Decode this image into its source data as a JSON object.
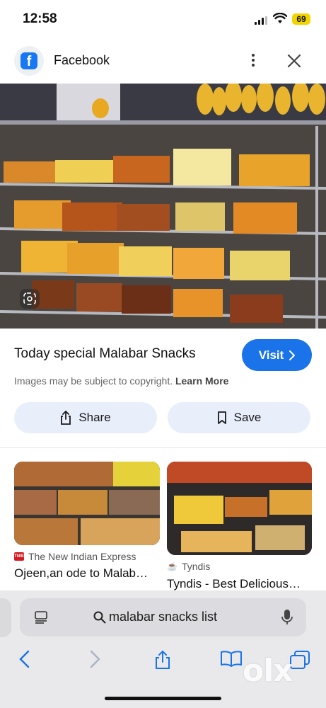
{
  "status_bar": {
    "time": "12:58",
    "battery": "69"
  },
  "header": {
    "app_title": "Facebook",
    "icons": [
      "facebook-logo-icon",
      "more-vertical-icon",
      "close-icon"
    ]
  },
  "result": {
    "title": "Today special Malabar Snacks",
    "visit_label": "Visit",
    "copyright_text": "Images may be subject to copyright.",
    "learn_more": "Learn More"
  },
  "actions": {
    "share_label": "Share",
    "save_label": "Save"
  },
  "related": [
    {
      "source": "The New Indian Express",
      "caption": "Ojeen,an ode to Malab…"
    },
    {
      "source": "Tyndis",
      "caption": "Tyndis - Best Delicious…"
    }
  ],
  "search": {
    "query": "malabar snacks list"
  },
  "watermark": "olx",
  "colors": {
    "accent": "#1a73e8",
    "pill_bg": "#e8effb",
    "battery": "#f2d400"
  }
}
